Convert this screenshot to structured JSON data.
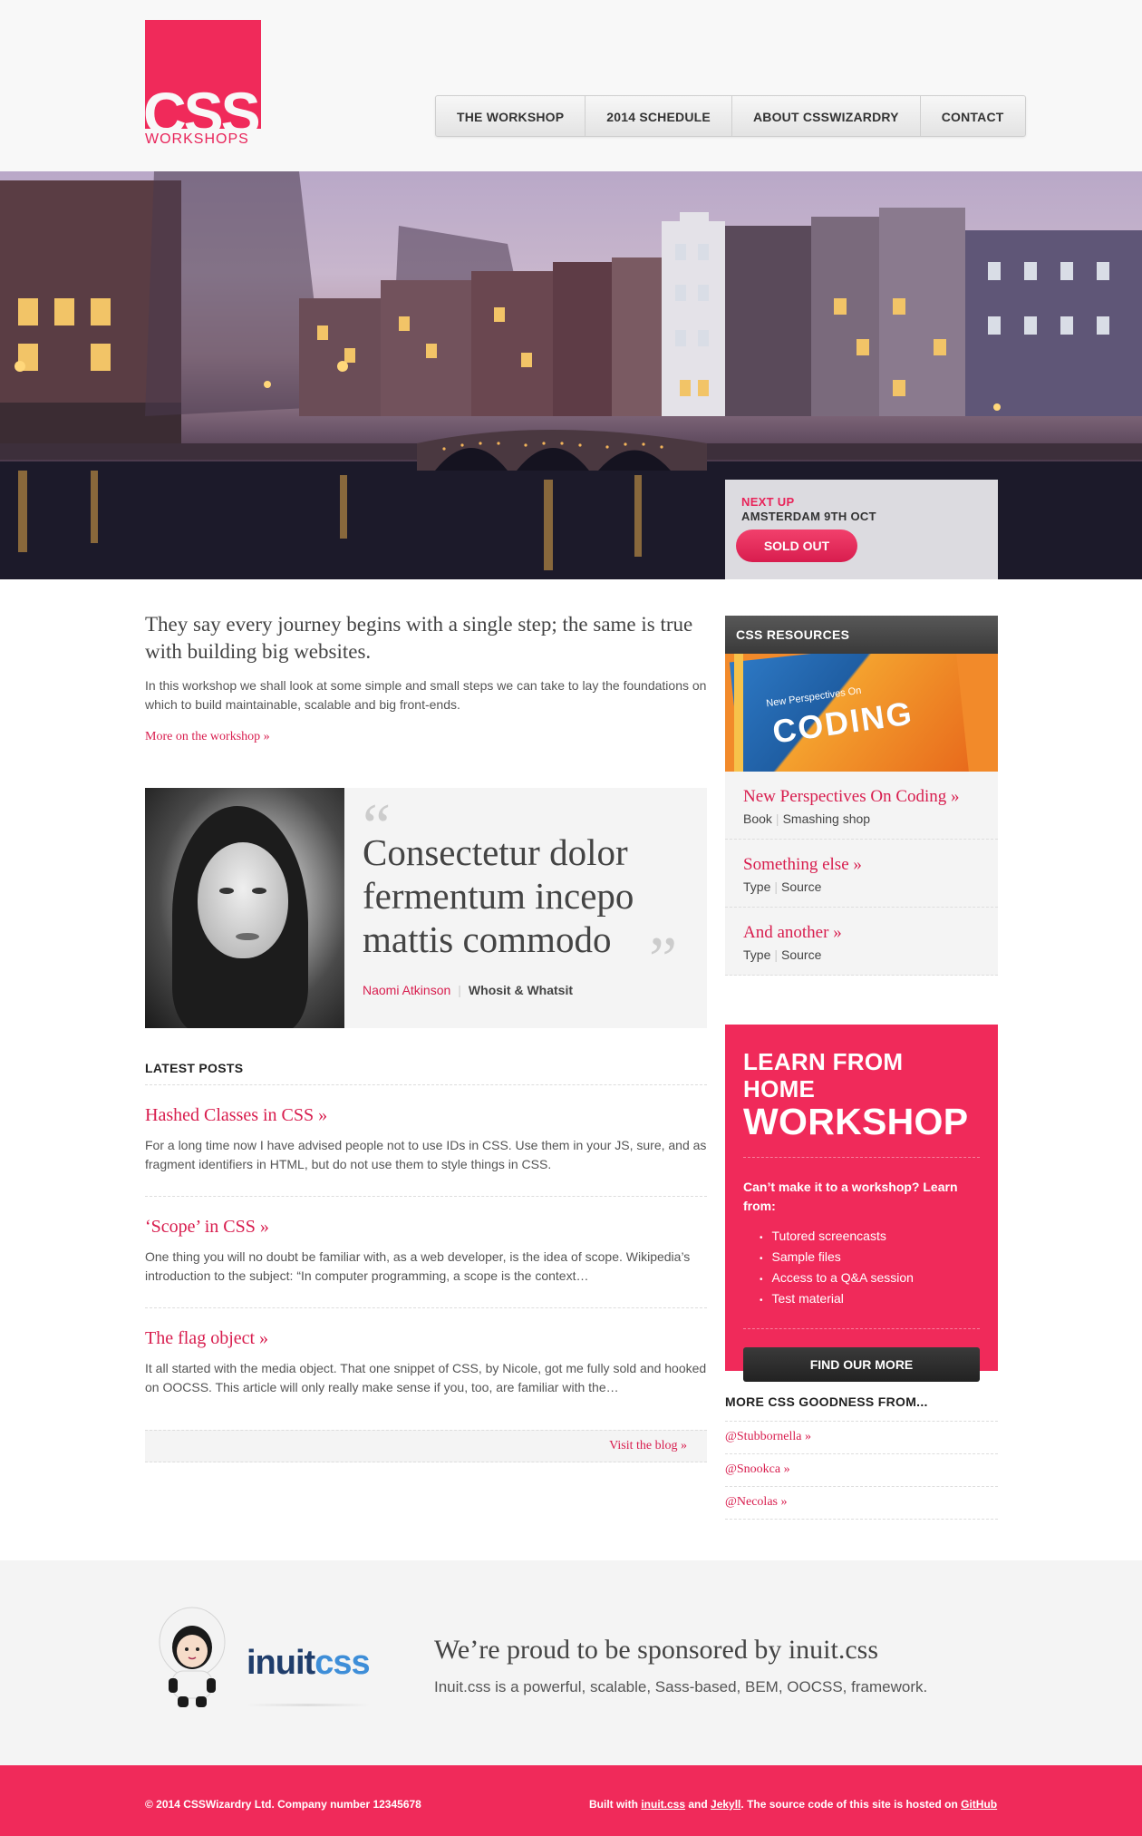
{
  "logo": {
    "css": "CSS",
    "subtitle": "WORKSHOPS"
  },
  "nav": {
    "items": [
      "THE WORKSHOP",
      "2014 SCHEDULE",
      "ABOUT CSSWIZARDRY",
      "CONTACT"
    ]
  },
  "hero": {
    "label": "NEXT UP",
    "place": "AMSTERDAM 9TH OCT",
    "button": "SOLD OUT"
  },
  "intro": {
    "heading": "They say every journey begins with a single step; the same is true with building big websites.",
    "body": "In this workshop we shall look at some simple and small steps we can take to lay the foundations on which to build maintainable, scalable and big front-ends.",
    "more": "More on the workshop »"
  },
  "quote": {
    "open_mark": "“",
    "close_mark": "”",
    "text": "Consectetur dolor fermentum incepo mattis commodo",
    "name": "Naomi Atkinson",
    "sep": "|",
    "role": "Whosit & Whatsit"
  },
  "posts": {
    "heading": "LATEST POSTS",
    "items": [
      {
        "title": "Hashed Classes in CSS »",
        "body": "For a long time now I have advised people not to use IDs in CSS. Use them in your JS, sure, and as fragment identifiers in HTML, but do not use them to style things in CSS."
      },
      {
        "title": "‘Scope’ in CSS »",
        "body": "One thing you will no doubt be familiar with, as a web developer, is the idea of scope. Wikipedia’s introduction to the subject:  “In computer programming, a scope is the context…"
      },
      {
        "title": "The flag object »",
        "body": "It all started with the media object. That one snippet of CSS, by Nicole, got me fully sold and hooked on OOCSS. This article will only really make sense if you, too, are familiar with the…"
      }
    ],
    "visit": "Visit the blog »"
  },
  "resources": {
    "heading": "CSS RESOURCES",
    "cover_small": "New Perspectives On",
    "cover_big": "CODING",
    "items": [
      {
        "title": "New Perspectives On Coding »",
        "meta1": "Book",
        "meta2": "Smashing shop"
      },
      {
        "title": "Something else »",
        "meta1": "Type",
        "meta2": "Source"
      },
      {
        "title": "And another »",
        "meta1": "Type",
        "meta2": "Source"
      }
    ],
    "sep": "|"
  },
  "learn": {
    "line1": "LEARN FROM HOME",
    "line2": "WORKSHOP",
    "question": "Can’t make it to a workshop? Learn from:",
    "list": [
      "Tutored screencasts",
      "Sample files",
      "Access to a Q&A session",
      "Test material"
    ],
    "button": "FIND OUR MORE"
  },
  "goodness": {
    "heading": "MORE CSS GOODNESS FROM...",
    "links": [
      "@Stubbornella »",
      "@Snookca »",
      "@Necolas »"
    ]
  },
  "sponsor": {
    "brand_a": "inuit",
    "brand_b": "css",
    "heading": "We’re proud to be sponsored by inuit.css",
    "body": "Inuit.css is a powerful, scalable, Sass-based, BEM, OOCSS, framework."
  },
  "footer": {
    "left": "© 2014 CSSWizardry Ltd. Company number 12345678",
    "r1": "Built with ",
    "r2": "inuit.css",
    "r3": " and ",
    "r4": "Jekyll",
    "r5": ". The source code of this site is hosted on ",
    "r6": "GitHub"
  },
  "colors": {
    "brand_pink": "#f02a5a",
    "link_pink": "#d81d4e",
    "dark_button": "#2b2b2b"
  }
}
